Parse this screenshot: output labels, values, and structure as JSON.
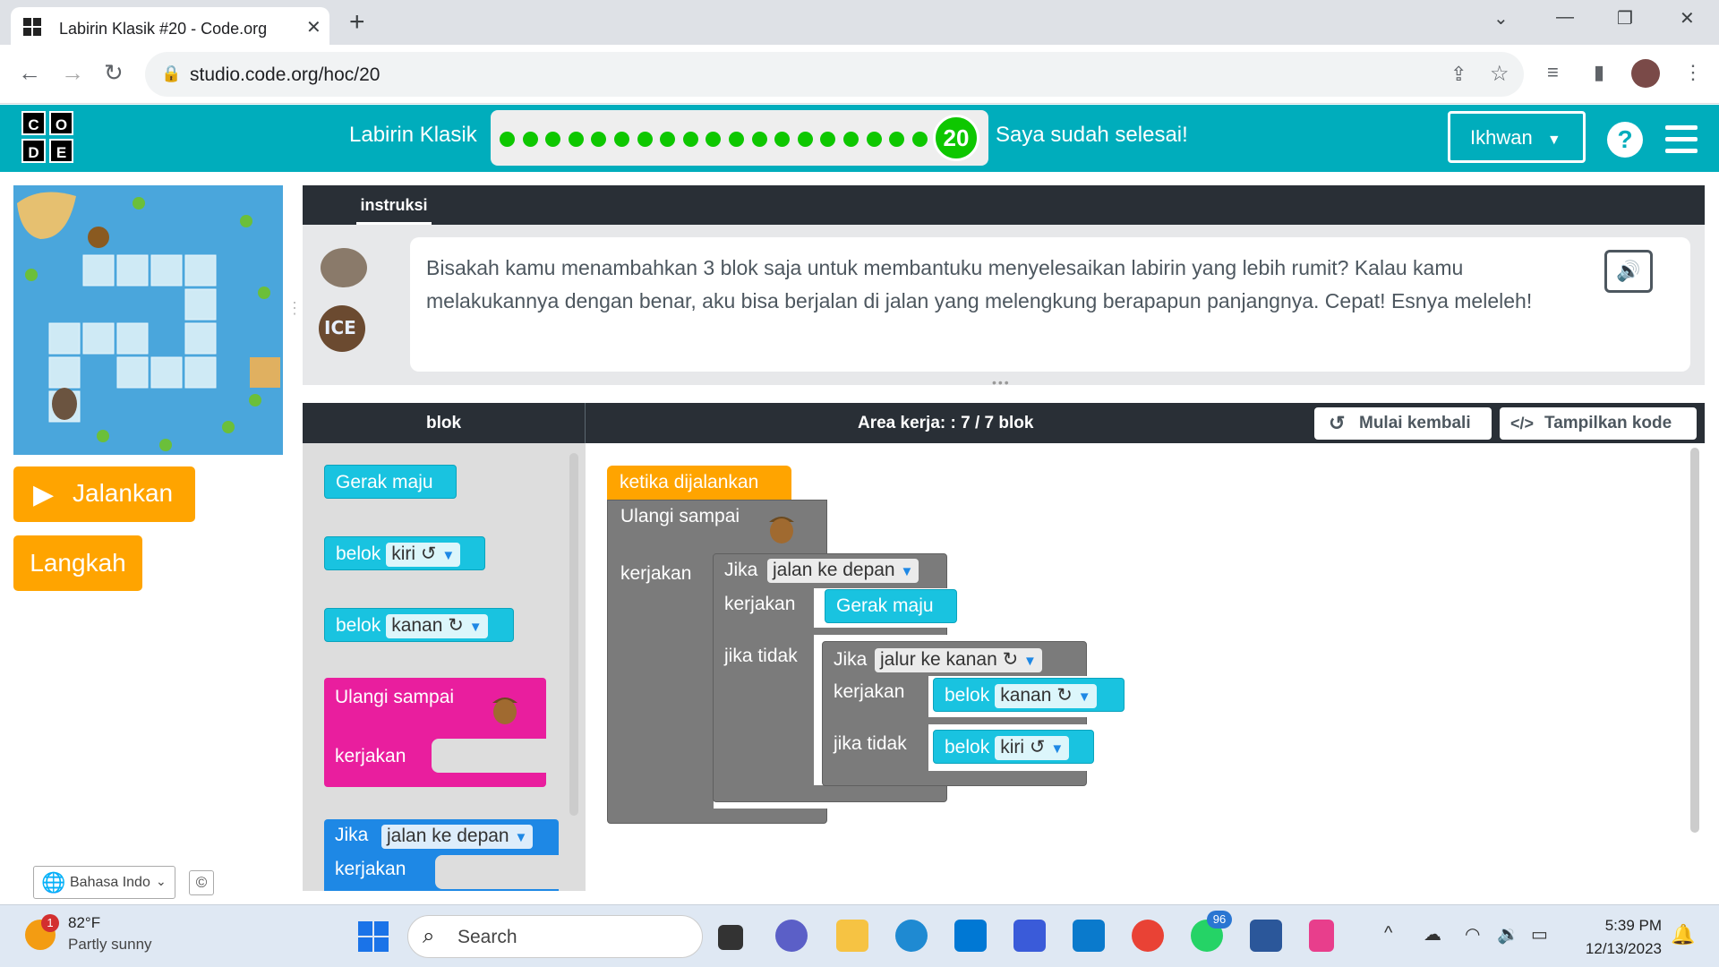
{
  "browser": {
    "tab_title": "Labirin Klasik #20 - Code.org",
    "url": "studio.code.org/hoc/20"
  },
  "header": {
    "logo_letters": [
      "C",
      "O",
      "D",
      "E"
    ],
    "level_title": "Labirin Klasik",
    "level_number": "20",
    "progress_dots_completed": 19,
    "finished_link": "Saya sudah selesai!",
    "user_name": "Ikhwan",
    "help_label": "?"
  },
  "game": {
    "run_button": "Jalankan",
    "step_button": "Langkah",
    "language": "Bahasa Indo",
    "cc_label": "©"
  },
  "instructions": {
    "tab_label": "instruksi",
    "text": "Bisakah kamu menambahkan 3 blok saja untuk membantuku menyelesaikan labirin yang lebih rumit? Kalau kamu melakukannya dengan benar, aku bisa berjalan di jalan yang melengkung berapapun panjangnya. Cepat! Esnya meleleh!"
  },
  "workspace_header": {
    "toolbox_title": "blok",
    "area_label": "Area kerja: : 7 / 7 blok",
    "reset_button": "Mulai kembali",
    "show_code_button": "Tampilkan kode"
  },
  "toolbox": {
    "move_forward": "Gerak maju",
    "turn": "belok",
    "left": "kiri ↺",
    "right": "kanan ↻",
    "repeat_until": "Ulangi sampai",
    "do": "kerjakan",
    "if": "Jika",
    "path_ahead": "jalan ke depan"
  },
  "program": {
    "when_run": "ketika dijalankan",
    "repeat_until": "Ulangi sampai",
    "do": "kerjakan",
    "if": "Jika",
    "path_ahead": "jalan ke depan",
    "else": "jika tidak",
    "move_forward": "Gerak maju",
    "path_right": "jalur ke kanan ↻",
    "turn": "belok",
    "right": "kanan ↻",
    "left": "kiri ↺"
  },
  "taskbar": {
    "temperature": "82°F",
    "weather": "Partly sunny",
    "weather_badge": "1",
    "search_placeholder": "Search",
    "whatsapp_badge": "96",
    "time": "5:39 PM",
    "date": "12/13/2023"
  },
  "colors": {
    "header": "#00adbc",
    "progress_green": "#0ec700",
    "run_orange": "#ffa400",
    "block_blue": "#19c3e0",
    "block_pink": "#e91e9e",
    "block_gray": "#7b7b7b"
  }
}
